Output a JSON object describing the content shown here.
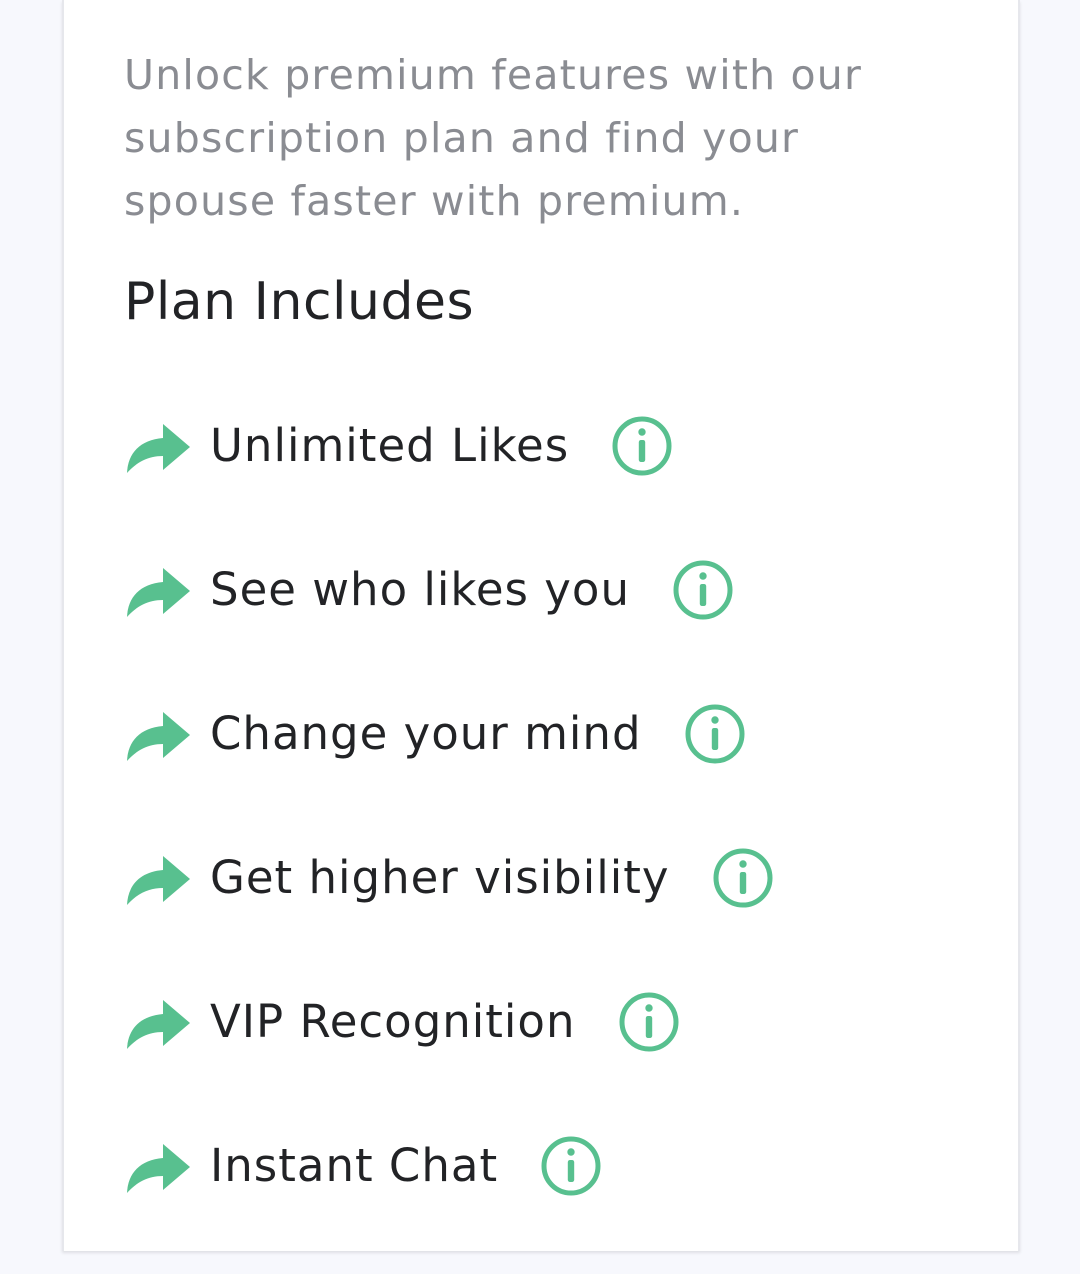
{
  "description": "Unlock premium features with our subscription plan and find your spouse faster with premium.",
  "plan": {
    "title": "Plan Includes",
    "features": [
      {
        "label": "Unlimited Likes",
        "icon": "arrow-right-icon",
        "info_icon": "info-icon"
      },
      {
        "label": "See who likes you",
        "icon": "arrow-right-icon",
        "info_icon": "info-icon"
      },
      {
        "label": "Change your mind",
        "icon": "arrow-right-icon",
        "info_icon": "info-icon"
      },
      {
        "label": "Get higher visibility",
        "icon": "arrow-right-icon",
        "info_icon": "info-icon"
      },
      {
        "label": "VIP Recognition",
        "icon": "arrow-right-icon",
        "info_icon": "info-icon"
      },
      {
        "label": "Instant Chat",
        "icon": "arrow-right-icon",
        "info_icon": "info-icon"
      }
    ]
  },
  "colors": {
    "accent": "#58c08f",
    "text_primary": "#222326",
    "text_secondary": "#8a8c92",
    "card_background": "#ffffff",
    "page_background": "#f7f8fd"
  }
}
